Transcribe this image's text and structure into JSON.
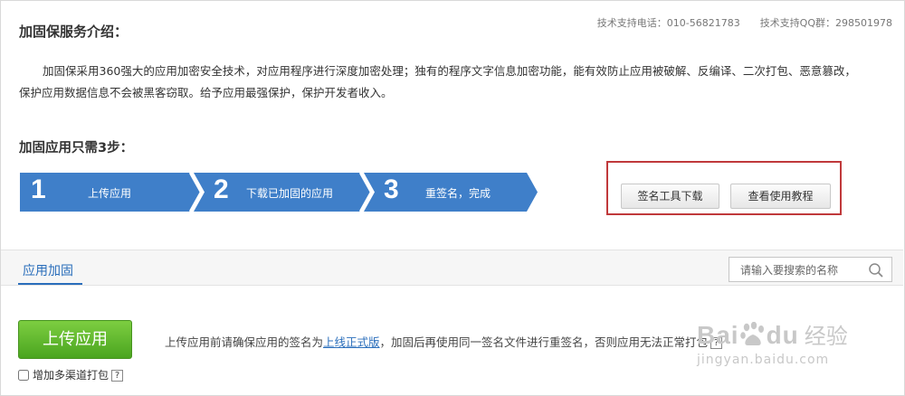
{
  "header": {
    "intro_title": "加固保服务介绍：",
    "contact_phone": "技术支持电话：010-56821783",
    "contact_qq": "技术支持QQ群：298501978"
  },
  "intro": {
    "text": "加固保采用360强大的应用加密安全技术，对应用程序进行深度加密处理；独有的程序文字信息加密功能，能有效防止应用被破解、反编译、二次打包、恶意篡改，保护应用数据信息不会被黑客窃取。给予应用最强保护，保护开发者收入。"
  },
  "steps": {
    "title": "加固应用只需3步：",
    "items": [
      {
        "num": "1",
        "label": "上传应用"
      },
      {
        "num": "2",
        "label": "下载已加固的应用"
      },
      {
        "num": "3",
        "label": "重签名，完成"
      }
    ],
    "color": "#3f7fc9"
  },
  "tools": {
    "sign_tool_download": "签名工具下载",
    "view_tutorial": "查看使用教程",
    "highlight_color": "#c0393b"
  },
  "tabs": {
    "active": "应用加固"
  },
  "search": {
    "placeholder": "请输入要搜索的名称"
  },
  "upload": {
    "button": "上传应用",
    "note_before": "上传应用前请确保应用的签名为",
    "note_link": "上线正式版",
    "note_after": "，加固后再使用同一签名文件进行重签名，否则应用无法正常打包",
    "help": "?",
    "multi_channel": "增加多渠道打包",
    "button_color": "#5cb82e"
  },
  "watermark": {
    "logo": "Bai",
    "logo_tail": "du",
    "cn": "经验",
    "url": "jingyan.baidu.com"
  }
}
